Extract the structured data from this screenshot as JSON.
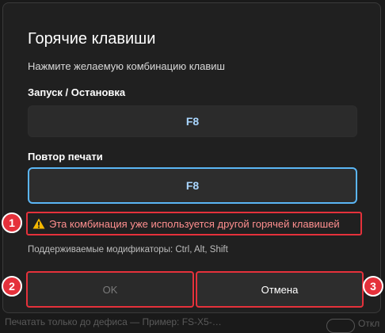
{
  "background": {
    "footer_text": "Печатать только до дефиса — Пример: FS-X5-…",
    "toggle_label": "Откл"
  },
  "dialog": {
    "title": "Горячие клавиши",
    "subtitle": "Нажмите желаемую комбинацию клавиш",
    "start_stop": {
      "label": "Запуск / Остановка",
      "value": "F8"
    },
    "repeat_print": {
      "label": "Повтор печати",
      "value": "F8"
    },
    "error_text": "Эта комбинация уже используется другой горячей клавишей",
    "hint": "Поддерживаемые модификаторы: Ctrl, Alt, Shift",
    "ok_label": "OK",
    "cancel_label": "Отмена"
  },
  "annotations": {
    "badge1": "1",
    "badge2": "2",
    "badge3": "3"
  },
  "colors": {
    "accent": "#5bb6f5",
    "error": "#e5313b",
    "warning": "#f5b800",
    "key_text": "#a9d6ff"
  }
}
